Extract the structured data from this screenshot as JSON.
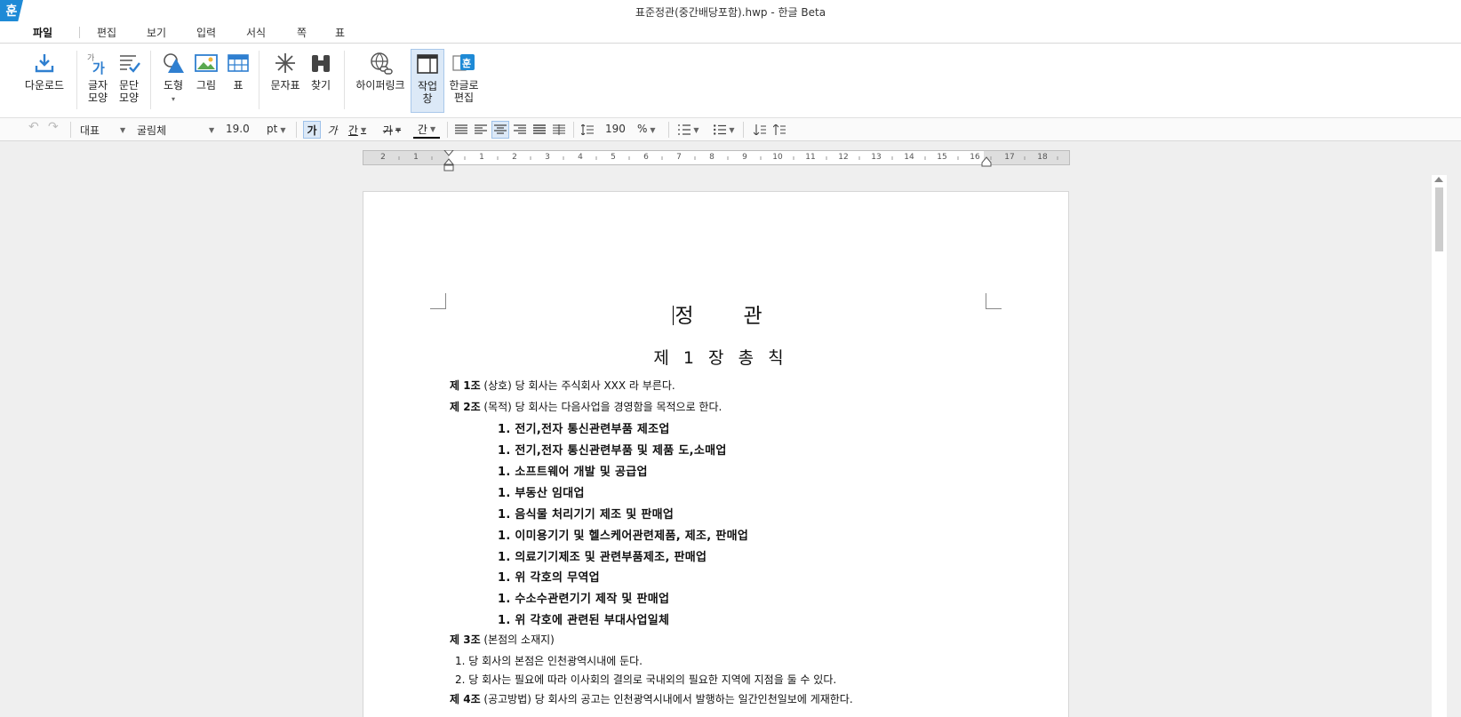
{
  "app": {
    "logo_glyph": "훈",
    "window_title": "표준정관(중간배당포함).hwp - 한글 Beta"
  },
  "menu": {
    "tabs": [
      {
        "label": "파일",
        "active": true
      },
      {
        "label": "편집"
      },
      {
        "label": "보기"
      },
      {
        "label": "입력"
      },
      {
        "label": "서식"
      },
      {
        "label": "쪽"
      },
      {
        "label": "표"
      }
    ]
  },
  "ribbon": {
    "download": "다운로드",
    "char_shape_1": "글자",
    "char_shape_2": "모양",
    "para_shape_1": "문단",
    "para_shape_2": "모양",
    "shape": "도형",
    "picture": "그림",
    "table": "표",
    "char_map": "문자표",
    "find": "찾기",
    "hyperlink": "하이퍼링크",
    "task_pane_1": "작업",
    "task_pane_2": "창",
    "edit_in_hangul_1": "한글로",
    "edit_in_hangul_2": "편집",
    "char_shape_icon_glyph": "가",
    "char_shape_icon_sup": "가",
    "edit_icon_glyph": "훈"
  },
  "format": {
    "style": "대표",
    "font": "굴림체",
    "size": "19.0",
    "unit": "pt",
    "bold_glyph": "가",
    "italic_glyph": "가",
    "underline_glyph": "간",
    "strike_glyph": "가",
    "color_glyph": "간",
    "line_spacing": "190",
    "line_spacing_unit": "%"
  },
  "ruler": {
    "labels": [
      "2",
      "1",
      "1",
      "2",
      "3",
      "4",
      "5",
      "6",
      "7",
      "8",
      "9",
      "10",
      "11",
      "12",
      "13",
      "14",
      "15",
      "16",
      "17",
      "18"
    ]
  },
  "document": {
    "title_1": "정",
    "title_2": "관",
    "chapter": "제 1 장  총  칙",
    "art1_head": "제 1조",
    "art1_body": " (상호) 당 회사는 주식회사 XXX 라 부른다.",
    "art2_head": "제 2조",
    "art2_body": " (목적) 당 회사는 다음사업을 경영함을 목적으로 한다.",
    "items": [
      "1. 전기,전자 통신관련부품 제조업",
      "1. 전기,전자 통신관련부품 및 제품 도,소매업",
      "1. 소프트웨어 개발 및 공급업",
      "1. 부동산 임대업",
      "1. 음식물 처리기기 제조 및 판매업",
      "1. 이미용기기 및 헬스케어관련제품, 제조, 판매업",
      "1. 의료기기제조 및 관련부품제조, 판매업",
      "1. 위 각호의 무역업",
      "1. 수소수관련기기 제작 및 판매업",
      "1. 위 각호에 관련된 부대사업일체"
    ],
    "art3_head": "제 3조",
    "art3_body": " (본점의 소재지)",
    "art3_1": "1. 당 회사의 본점은 인천광역시내에 둔다.",
    "art3_2": "2. 당 회사는 필요에 따라 이사회의 결의로 국내외의 필요한 지역에 지점을 둘 수 있다.",
    "art4_head": "제 4조",
    "art4_body": " (공고방법) 당 회사의 공고는 인천광역시내에서 발행하는 일간인천일보에 게재한다."
  }
}
